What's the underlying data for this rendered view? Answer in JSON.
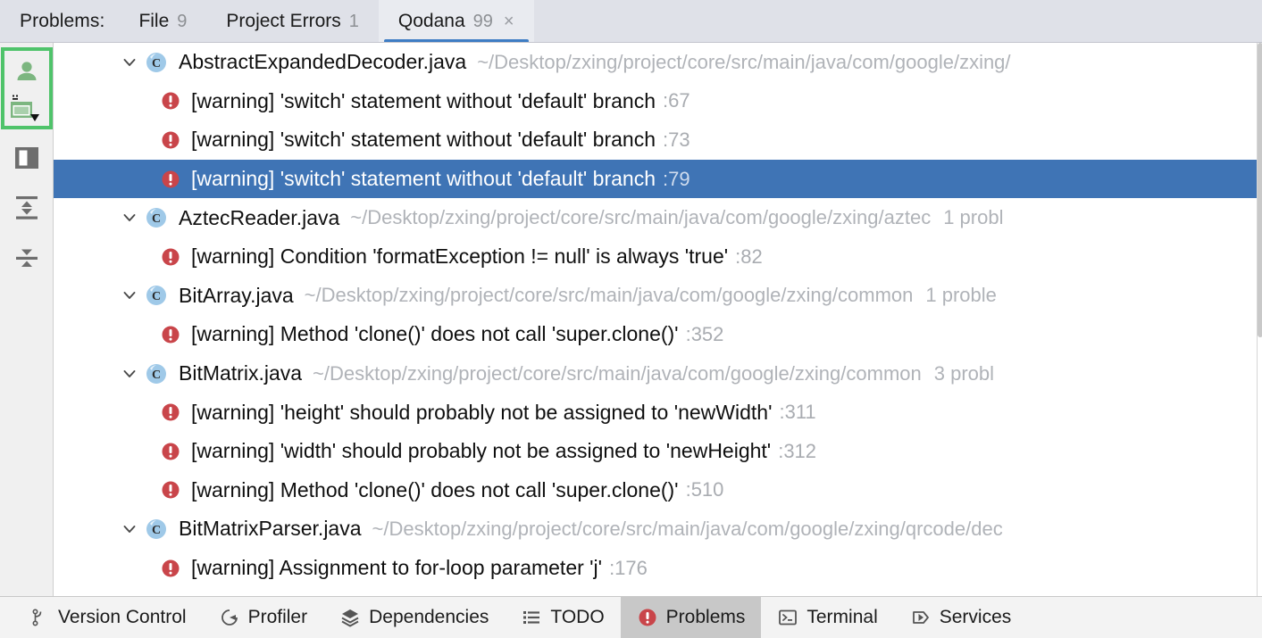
{
  "header": {
    "title": "Problems:",
    "tabs": [
      {
        "label": "File",
        "count": "9",
        "active": false,
        "closable": false
      },
      {
        "label": "Project Errors",
        "count": "1",
        "active": false,
        "closable": false
      },
      {
        "label": "Qodana",
        "count": "99",
        "active": true,
        "closable": true,
        "close_glyph": "×"
      }
    ]
  },
  "left_toolbar": {
    "highlighted": true,
    "highlight_color": "#4fc36a",
    "items": [
      {
        "name": "user-profile-icon",
        "label": ""
      },
      {
        "name": "preview-panel-dropdown-icon",
        "label": ""
      },
      {
        "name": "split-view-icon",
        "label": ""
      },
      {
        "name": "expand-all-icon",
        "label": ""
      },
      {
        "name": "collapse-all-icon",
        "label": ""
      }
    ]
  },
  "tree": {
    "selected_index": 3,
    "selection_color": "#3f74b5",
    "rows": [
      {
        "kind": "file",
        "expanded": true,
        "icon": "java-class-icon",
        "name": "AbstractExpandedDecoder.java",
        "path": "~/Desktop/zxing/project/core/src/main/java/com/google/zxing/",
        "problems": ""
      },
      {
        "kind": "problem",
        "icon": "error-icon",
        "message": "[warning] 'switch' statement without 'default' branch",
        "line": ":67"
      },
      {
        "kind": "problem",
        "icon": "error-icon",
        "message": "[warning] 'switch' statement without 'default' branch",
        "line": ":73"
      },
      {
        "kind": "problem",
        "icon": "error-icon",
        "message": "[warning] 'switch' statement without 'default' branch",
        "line": ":79"
      },
      {
        "kind": "file",
        "expanded": true,
        "icon": "java-class-icon",
        "name": "AztecReader.java",
        "path": "~/Desktop/zxing/project/core/src/main/java/com/google/zxing/aztec",
        "problems": "1 probl"
      },
      {
        "kind": "problem",
        "icon": "error-icon",
        "message": "[warning] Condition 'formatException != null' is always 'true'",
        "line": ":82"
      },
      {
        "kind": "file",
        "expanded": true,
        "icon": "java-class-icon",
        "name": "BitArray.java",
        "path": "~/Desktop/zxing/project/core/src/main/java/com/google/zxing/common",
        "problems": "1 proble"
      },
      {
        "kind": "problem",
        "icon": "error-icon",
        "message": "[warning] Method 'clone()' does not call 'super.clone()'",
        "line": ":352"
      },
      {
        "kind": "file",
        "expanded": true,
        "icon": "java-class-icon",
        "name": "BitMatrix.java",
        "path": "~/Desktop/zxing/project/core/src/main/java/com/google/zxing/common",
        "problems": "3 probl"
      },
      {
        "kind": "problem",
        "icon": "error-icon",
        "message": "[warning] 'height' should probably not be assigned to 'newWidth'",
        "line": ":311"
      },
      {
        "kind": "problem",
        "icon": "error-icon",
        "message": "[warning] 'width' should probably not be assigned to 'newHeight'",
        "line": ":312"
      },
      {
        "kind": "problem",
        "icon": "error-icon",
        "message": "[warning] Method 'clone()' does not call 'super.clone()'",
        "line": ":510"
      },
      {
        "kind": "file",
        "expanded": true,
        "icon": "java-class-icon",
        "name": "BitMatrixParser.java",
        "path": "~/Desktop/zxing/project/core/src/main/java/com/google/zxing/qrcode/dec",
        "problems": ""
      },
      {
        "kind": "problem",
        "icon": "error-icon",
        "message": "[warning] Assignment to for-loop parameter 'j'",
        "line": ":176"
      }
    ]
  },
  "statusbar": {
    "items": [
      {
        "label": "Version Control",
        "icon": "branch-icon",
        "active": false
      },
      {
        "label": "Profiler",
        "icon": "profiler-icon",
        "active": false
      },
      {
        "label": "Dependencies",
        "icon": "layers-icon",
        "active": false
      },
      {
        "label": "TODO",
        "icon": "list-icon",
        "active": false
      },
      {
        "label": "Problems",
        "icon": "error-icon",
        "active": true
      },
      {
        "label": "Terminal",
        "icon": "terminal-icon",
        "active": false
      },
      {
        "label": "Services",
        "icon": "play-icon",
        "active": false
      }
    ]
  },
  "colors": {
    "accent": "#3e7dc4",
    "selection": "#3f74b5",
    "error": "#c9454a",
    "highlight": "#4fc36a",
    "header_bg": "#dfe1e8"
  }
}
